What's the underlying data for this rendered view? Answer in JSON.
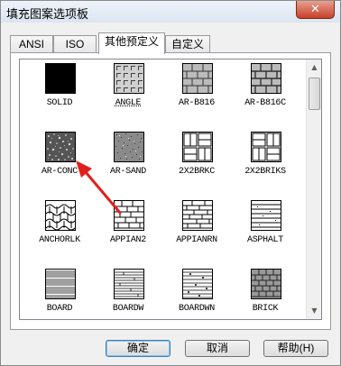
{
  "window": {
    "title": "填充图案选项板",
    "close_glyph": "✕"
  },
  "tabs": [
    {
      "label": "ANSI"
    },
    {
      "label": "ISO"
    },
    {
      "label": "其他预定义",
      "active": true
    },
    {
      "label": "自定义"
    }
  ],
  "patterns": [
    {
      "label": "SOLID",
      "icon": "solid-pattern"
    },
    {
      "label": "ANGLE",
      "icon": "angle-pattern",
      "selected": true
    },
    {
      "label": "AR-B816",
      "icon": "brick-pattern"
    },
    {
      "label": "AR-B816C",
      "icon": "brick-pattern"
    },
    {
      "label": "AR-CONC",
      "icon": "concrete-pattern"
    },
    {
      "label": "AR-SAND",
      "icon": "sand-pattern"
    },
    {
      "label": "2X2BRKC",
      "icon": "basketweave-pattern"
    },
    {
      "label": "2X2BRIKS",
      "icon": "basketweave-pattern"
    },
    {
      "label": "ANCHORLK",
      "icon": "anchorlock-pattern"
    },
    {
      "label": "APPIAN2",
      "icon": "appian-brick-pattern"
    },
    {
      "label": "APPIANRN",
      "icon": "appian-pattern"
    },
    {
      "label": "ASPHALT",
      "icon": "asphalt-pattern"
    },
    {
      "label": "BOARD",
      "icon": "board-pattern"
    },
    {
      "label": "BOARDW",
      "icon": "board-pattern"
    },
    {
      "label": "BOARDWN",
      "icon": "boardwn-pattern"
    },
    {
      "label": "BRICK",
      "icon": "brick-pattern"
    }
  ],
  "buttons": {
    "ok": "确定",
    "cancel": "取消",
    "help": "帮助(H)"
  },
  "annotation": {
    "arrow_color": "#e0201c"
  }
}
